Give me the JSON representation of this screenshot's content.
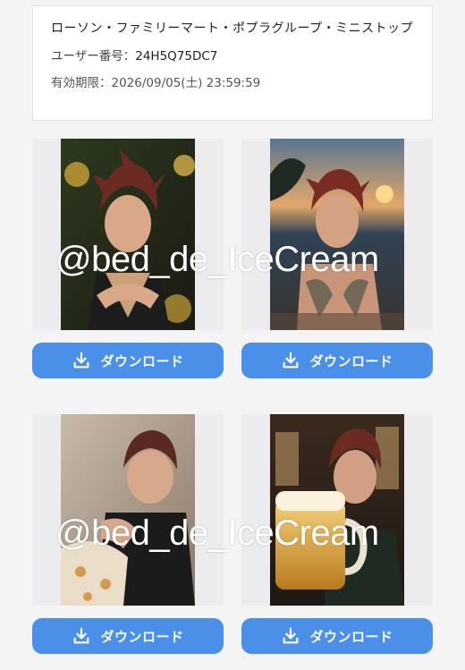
{
  "info": {
    "stores": "ローソン・ファミリーマート・ポプラグループ・ミニストップ",
    "user_label": "ユーザー番号：",
    "user_value": "24H5Q75DC7",
    "expiry_label": "有効期限：",
    "expiry_value": "2026/09/05(土) 23:59:59"
  },
  "tiles": [
    {
      "download_label": "ダウンロード",
      "download_icon": "download-icon"
    },
    {
      "download_label": "ダウンロード",
      "download_icon": "download-icon"
    },
    {
      "download_label": "ダウンロード",
      "download_icon": "download-icon"
    },
    {
      "download_label": "ダウンロード",
      "download_icon": "download-icon"
    }
  ],
  "watermarks": [
    "@bed_de_IceCream",
    "@bed_de_IceCream"
  ],
  "colors": {
    "button": "#4a90e8",
    "tile_bg": "#ececee",
    "page_bg": "#f4f4f5"
  }
}
